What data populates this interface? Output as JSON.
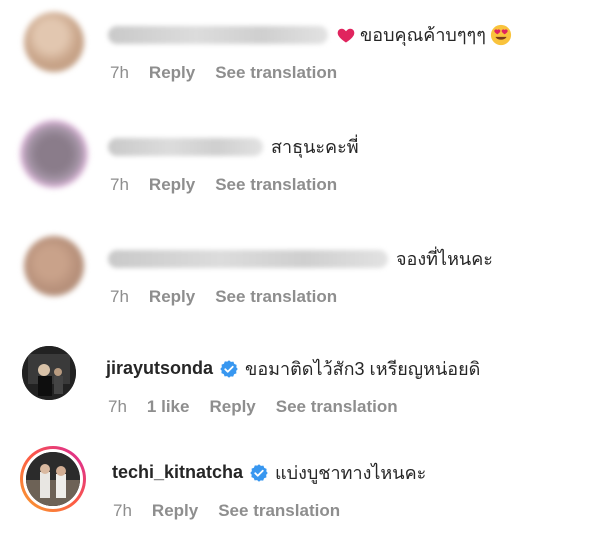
{
  "comments": [
    {
      "username": "",
      "text": "ขอบคุณค้าบๆๆๆ",
      "emoji_before": "heart-emoji",
      "emoji_after": "heart-eyes-emoji",
      "time": "7h",
      "reply": "Reply",
      "see_translation": "See translation"
    },
    {
      "username": "",
      "text": "สาธุนะคะพี่",
      "time": "7h",
      "reply": "Reply",
      "see_translation": "See translation"
    },
    {
      "username": "",
      "text": "จองที่ไหนคะ",
      "time": "7h",
      "reply": "Reply",
      "see_translation": "See translation"
    },
    {
      "username": "jirayutsonda",
      "verified": true,
      "text": "ขอมาติดไว้สัก3 เหรียญหน่อยดิ",
      "time": "7h",
      "likes": "1 like",
      "reply": "Reply",
      "see_translation": "See translation"
    },
    {
      "username": "techi_kitnatcha",
      "verified": true,
      "story_ring": true,
      "text": "แบ่งบูชาทางไหนคะ",
      "time": "7h",
      "reply": "Reply",
      "see_translation": "See translation"
    }
  ],
  "colors": {
    "text": "#262626",
    "meta": "#8e8e8e",
    "verified": "#3897f0",
    "story_ring_start": "#f9a12e",
    "story_ring_end": "#d6249f"
  }
}
